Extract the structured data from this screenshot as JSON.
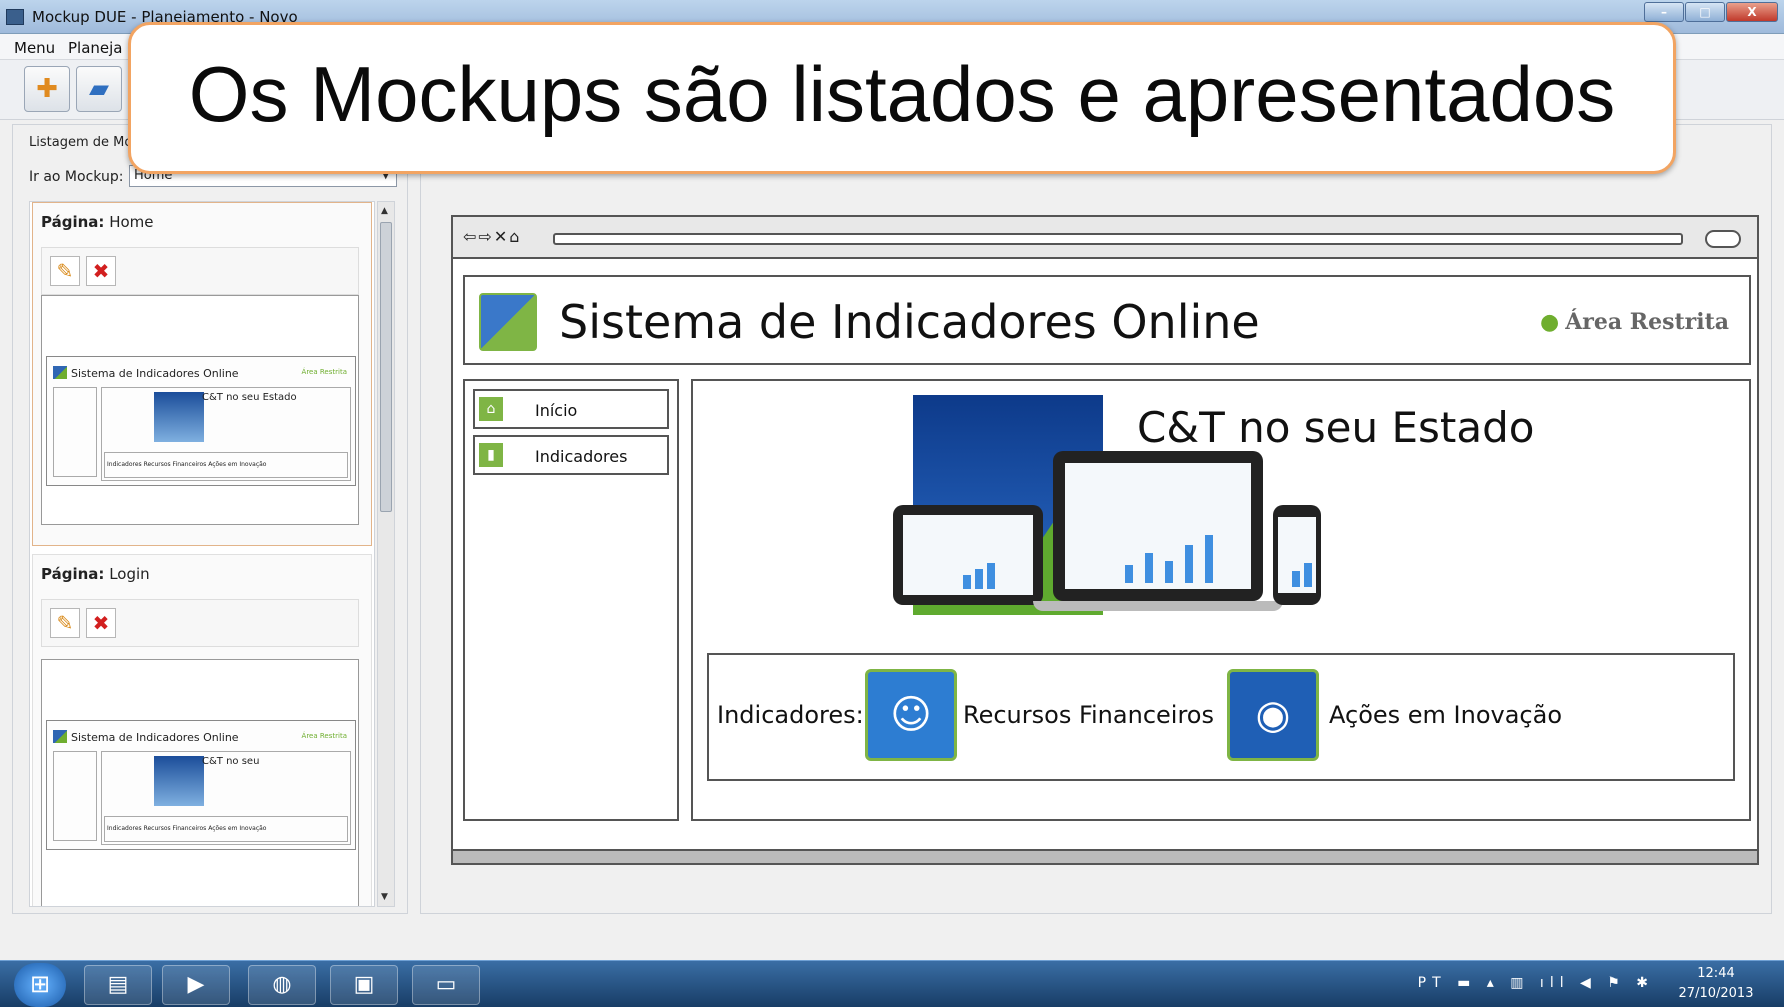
{
  "window": {
    "title": "Mockup DUE - Planejamento - Novo",
    "controls": [
      "–",
      "□",
      "X"
    ]
  },
  "menu": {
    "items": [
      "Menu",
      "Planeja"
    ]
  },
  "left": {
    "list_label": "Listagem de Mo",
    "goto_label": "Ir ao Mockup:",
    "goto_value": "Home",
    "pages": [
      {
        "label_bold": "Página:",
        "label": "Home",
        "thumb": {
          "title": "Sistema de Indicadores Online",
          "area": "Área Restrita",
          "heading": "C&T no seu Estado",
          "footer": "Indicadores   Recursos Financeiros   Ações em Inovação"
        }
      },
      {
        "label_bold": "Página:",
        "label": "Login",
        "thumb": {
          "title": "Sistema de Indicadores Online",
          "area": "Área Restrita",
          "heading": "C&T no seu",
          "footer": "Indicadores   Recursos Financeiros   Ações em Inovação"
        }
      }
    ]
  },
  "preview": {
    "site_title": "Sistema de Indicadores Online",
    "area_restrita": "Área Restrita",
    "nav": [
      "Início",
      "Indicadores"
    ],
    "hero_title": "C&T no seu Estado",
    "footer_label": "Indicadores:",
    "footer_items": [
      "Recursos Financeiros",
      "Ações em Inovação"
    ]
  },
  "callout": {
    "text": "Os Mockups são listados e apresentados"
  },
  "taskbar": {
    "tray": "PT",
    "time": "12:44",
    "date": "27/10/2013"
  },
  "colors": {
    "accent_green": "#7fb545",
    "callout_border": "#f2a462",
    "taskbar": "#183d66"
  }
}
